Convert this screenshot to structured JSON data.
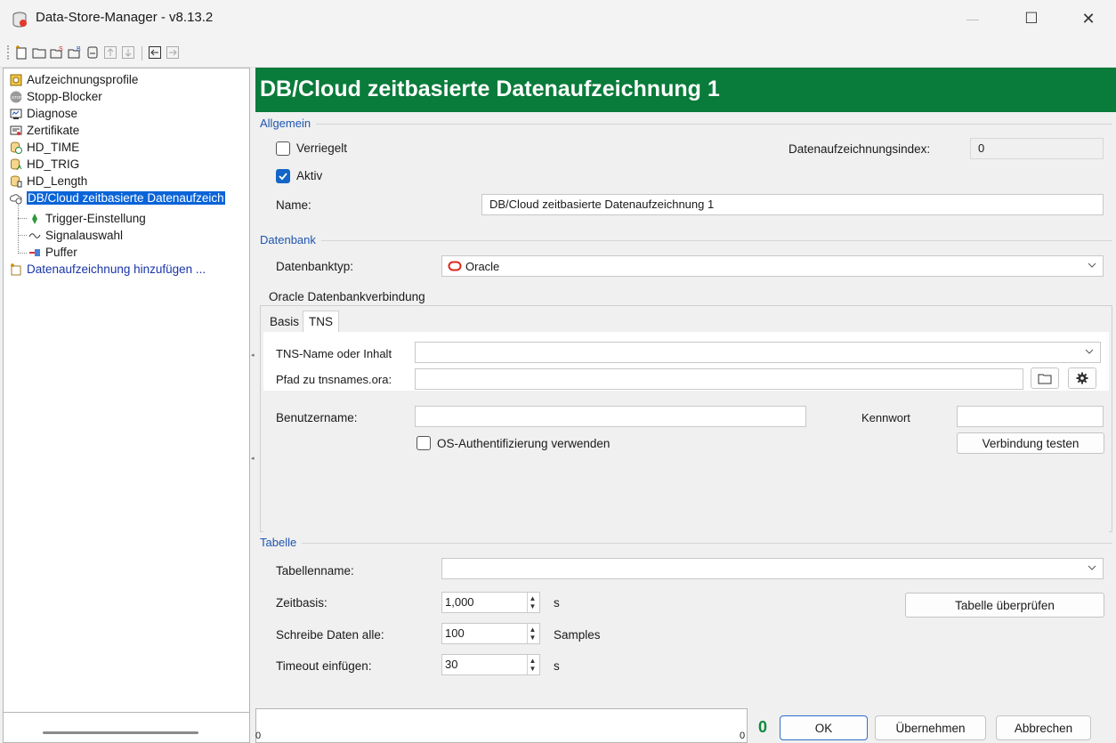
{
  "window": {
    "title": "Data-Store-Manager - v8.13.2",
    "minimize": "—",
    "maximize": "☐",
    "close": "✕"
  },
  "tree": {
    "items": [
      {
        "label": "Aufzeichnungsprofile",
        "icon": "profiles-icon"
      },
      {
        "label": "Stopp-Blocker",
        "icon": "stop-icon"
      },
      {
        "label": "Diagnose",
        "icon": "diagnose-icon"
      },
      {
        "label": "Zertifikate",
        "icon": "certificate-icon"
      },
      {
        "label": "HD_TIME",
        "icon": "time-recording-icon"
      },
      {
        "label": "HD_TRIG",
        "icon": "trigger-recording-icon"
      },
      {
        "label": "HD_Length",
        "icon": "length-recording-icon"
      },
      {
        "label": "DB/Cloud zeitbasierte Datenaufzeich",
        "icon": "cloud-recording-icon"
      },
      {
        "label": "Trigger-Einstellung",
        "icon": "trigger-icon"
      },
      {
        "label": "Signalauswahl",
        "icon": "signal-icon"
      },
      {
        "label": "Puffer",
        "icon": "buffer-icon"
      },
      {
        "label": "Datenaufzeichnung hinzufügen ...",
        "icon": "add-recording-icon"
      }
    ]
  },
  "header": {
    "title": "DB/Cloud zeitbasierte Datenaufzeichnung 1"
  },
  "allgemein": {
    "section": "Allgemein",
    "locked_label": "Verriegelt",
    "active_label": "Aktiv",
    "index_label": "Datenaufzeichnungsindex:",
    "index_value": "0",
    "name_label": "Name:",
    "name_value": "DB/Cloud zeitbasierte Datenaufzeichnung 1"
  },
  "datenbank": {
    "section": "Datenbank",
    "type_label": "Datenbanktyp:",
    "type_value": "Oracle",
    "group_title": "Oracle Datenbankverbindung",
    "tabs": [
      "Basis",
      "TNS"
    ],
    "tns_name_label": "TNS-Name oder Inhalt",
    "tns_name_value": "",
    "tnsnames_path_label": "Pfad zu tnsnames.ora:",
    "tnsnames_path_value": "",
    "username_label": "Benutzername:",
    "username_value": "",
    "password_label": "Kennwort",
    "password_value": "",
    "os_auth_label": "OS-Authentifizierung verwenden",
    "test_button": "Verbindung testen"
  },
  "tabelle": {
    "section": "Tabelle",
    "table_name_label": "Tabellenname:",
    "table_name_value": "",
    "zeitbasis_label": "Zeitbasis:",
    "zeitbasis_value": "1,000",
    "zeitbasis_unit": "s",
    "write_label": "Schreibe Daten alle:",
    "write_value": "100",
    "write_unit": "Samples",
    "timeout_label": "Timeout einfügen:",
    "timeout_value": "30",
    "timeout_unit": "s",
    "check_button": "Tabelle überprüfen"
  },
  "footer": {
    "status_left": "0",
    "status_right": "0",
    "counter": "0",
    "ok": "OK",
    "apply": "Übernehmen",
    "cancel": "Abbrechen"
  },
  "colors": {
    "header_bg": "#097b3a",
    "section_label": "#1e55b0",
    "selection": "#0a64d8",
    "counter": "#0d8a3c"
  }
}
